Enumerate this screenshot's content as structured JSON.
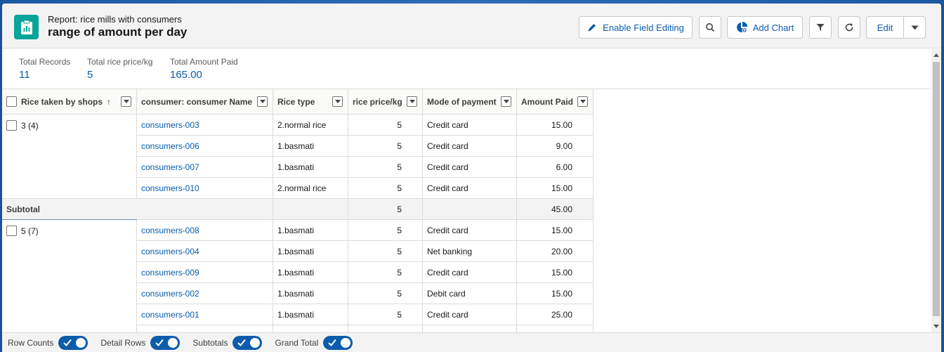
{
  "header": {
    "subtitle": "Report: rice mills with consumers",
    "title": "range of amount per day",
    "buttons": {
      "enable_field_editing": "Enable Field Editing",
      "add_chart": "Add Chart",
      "edit": "Edit"
    },
    "colors": {
      "brand": "#06a59a",
      "link": "#0b5cab"
    }
  },
  "summary": [
    {
      "label": "Total Records",
      "value": "11"
    },
    {
      "label": "Total rice price/kg",
      "value": "5"
    },
    {
      "label": "Total Amount Paid",
      "value": "165.00"
    }
  ],
  "columns": {
    "group": "Rice taken by shops",
    "group_sort": "↑",
    "consumer": "consumer: consumer Name",
    "rice_type": "Rice type",
    "price": "rice price/kg",
    "payment": "Mode of payment",
    "amount": "Amount Paid"
  },
  "groups": [
    {
      "label": "3 (4)",
      "rows": [
        {
          "consumer": "consumers-003",
          "rice_type": "2.normal rice",
          "price": "5",
          "payment": "Credit card",
          "amount": "15.00"
        },
        {
          "consumer": "consumers-006",
          "rice_type": "1.basmati",
          "price": "5",
          "payment": "Credit card",
          "amount": "9.00"
        },
        {
          "consumer": "consumers-007",
          "rice_type": "1.basmati",
          "price": "5",
          "payment": "Credit card",
          "amount": "6.00"
        },
        {
          "consumer": "consumers-010",
          "rice_type": "2.normal rice",
          "price": "5",
          "payment": "Credit card",
          "amount": "15.00"
        }
      ],
      "subtotal": {
        "label": "Subtotal",
        "price": "5",
        "amount": "45.00"
      }
    },
    {
      "label": "5 (7)",
      "rows": [
        {
          "consumer": "consumers-008",
          "rice_type": "1.basmati",
          "price": "5",
          "payment": "Credit card",
          "amount": "15.00"
        },
        {
          "consumer": "consumers-004",
          "rice_type": "1.basmati",
          "price": "5",
          "payment": "Net banking",
          "amount": "20.00"
        },
        {
          "consumer": "consumers-009",
          "rice_type": "1.basmati",
          "price": "5",
          "payment": "Credit card",
          "amount": "15.00"
        },
        {
          "consumer": "consumers-002",
          "rice_type": "1.basmati",
          "price": "5",
          "payment": "Debit card",
          "amount": "15.00"
        },
        {
          "consumer": "consumers-001",
          "rice_type": "1.basmati",
          "price": "5",
          "payment": "Credit card",
          "amount": "25.00"
        }
      ]
    }
  ],
  "footer": {
    "row_counts": "Row Counts",
    "detail_rows": "Detail Rows",
    "subtotals": "Subtotals",
    "grand_total": "Grand Total"
  }
}
